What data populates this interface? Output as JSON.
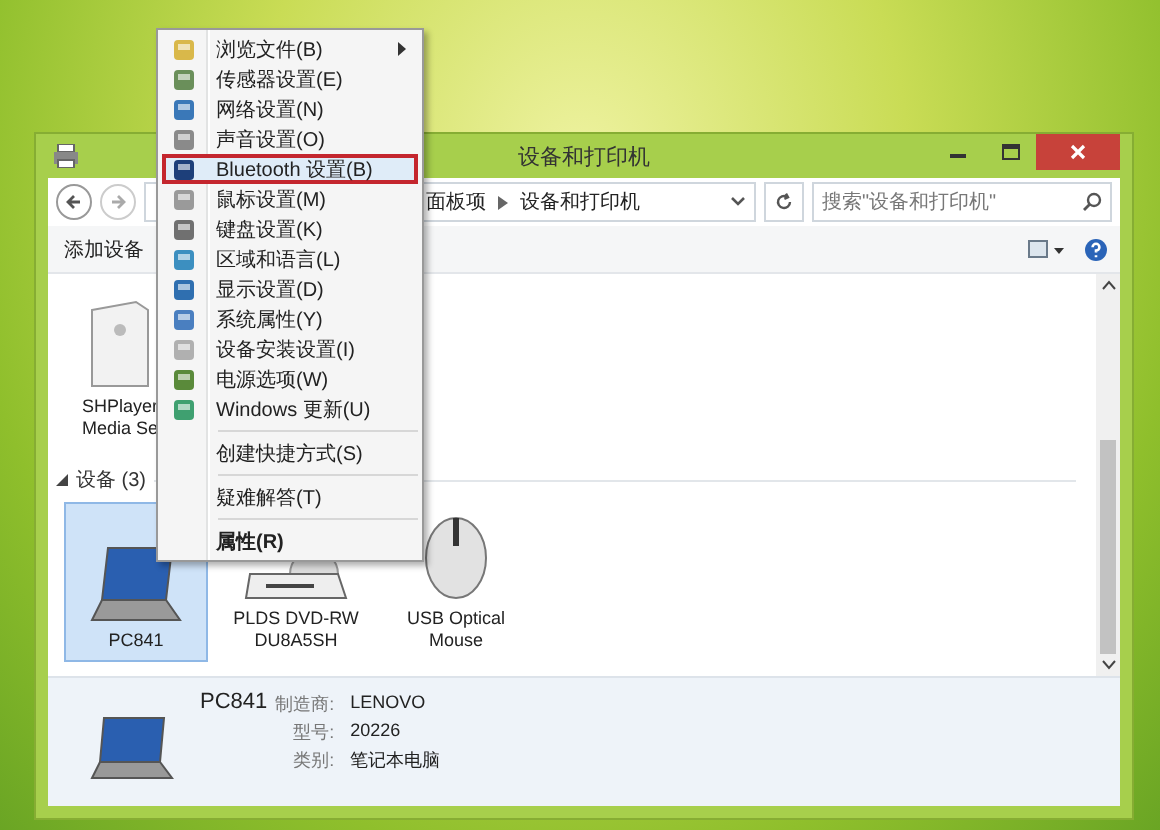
{
  "window": {
    "title": "设备和打印机"
  },
  "address_bar": {
    "path": [
      "面板项",
      "设备和打印机"
    ],
    "search_placeholder": "搜索\"设备和打印机\""
  },
  "toolbar": {
    "buttons": [
      "添加设备"
    ]
  },
  "top_group": {
    "items": [
      {
        "lines": [
          "SHPlayer",
          "Media Se"
        ],
        "kind": "server",
        "selected": false
      }
    ]
  },
  "device_group": {
    "header": "设备 (3)",
    "expanded": true,
    "items": [
      {
        "lines": [
          "PC841"
        ],
        "kind": "laptop",
        "selected": true
      },
      {
        "lines": [
          "PLDS DVD-RW",
          "DU8A5SH"
        ],
        "kind": "drive",
        "selected": false
      },
      {
        "lines": [
          "USB Optical",
          "Mouse"
        ],
        "kind": "mouse",
        "selected": false
      }
    ]
  },
  "details": {
    "name": "PC841",
    "fields": [
      {
        "label": "制造商:",
        "value": "LENOVO"
      },
      {
        "label": "型号:",
        "value": "20226"
      },
      {
        "label": "类别:",
        "value": "笔记本电脑"
      }
    ]
  },
  "context_menu": {
    "groups": [
      [
        {
          "label": "浏览文件(B)",
          "submenu": true,
          "selected": false,
          "bold": false
        },
        {
          "label": "传感器设置(E)",
          "submenu": false,
          "selected": false,
          "bold": false
        },
        {
          "label": "网络设置(N)",
          "submenu": false,
          "selected": false,
          "bold": false
        },
        {
          "label": "声音设置(O)",
          "submenu": false,
          "selected": false,
          "bold": false
        },
        {
          "label": "Bluetooth 设置(B)",
          "submenu": false,
          "selected": true,
          "bold": false
        },
        {
          "label": "鼠标设置(M)",
          "submenu": false,
          "selected": false,
          "bold": false
        },
        {
          "label": "键盘设置(K)",
          "submenu": false,
          "selected": false,
          "bold": false
        },
        {
          "label": "区域和语言(L)",
          "submenu": false,
          "selected": false,
          "bold": false
        },
        {
          "label": "显示设置(D)",
          "submenu": false,
          "selected": false,
          "bold": false
        },
        {
          "label": "系统属性(Y)",
          "submenu": false,
          "selected": false,
          "bold": false
        },
        {
          "label": "设备安装设置(I)",
          "submenu": false,
          "selected": false,
          "bold": false
        },
        {
          "label": "电源选项(W)",
          "submenu": false,
          "selected": false,
          "bold": false
        },
        {
          "label": "Windows 更新(U)",
          "submenu": false,
          "selected": false,
          "bold": false
        }
      ],
      [
        {
          "label": "创建快捷方式(S)",
          "submenu": false,
          "selected": false,
          "bold": false
        }
      ],
      [
        {
          "label": "疑难解答(T)",
          "submenu": false,
          "selected": false,
          "bold": false
        }
      ],
      [
        {
          "label": "属性(R)",
          "submenu": false,
          "selected": false,
          "bold": true
        }
      ]
    ]
  }
}
